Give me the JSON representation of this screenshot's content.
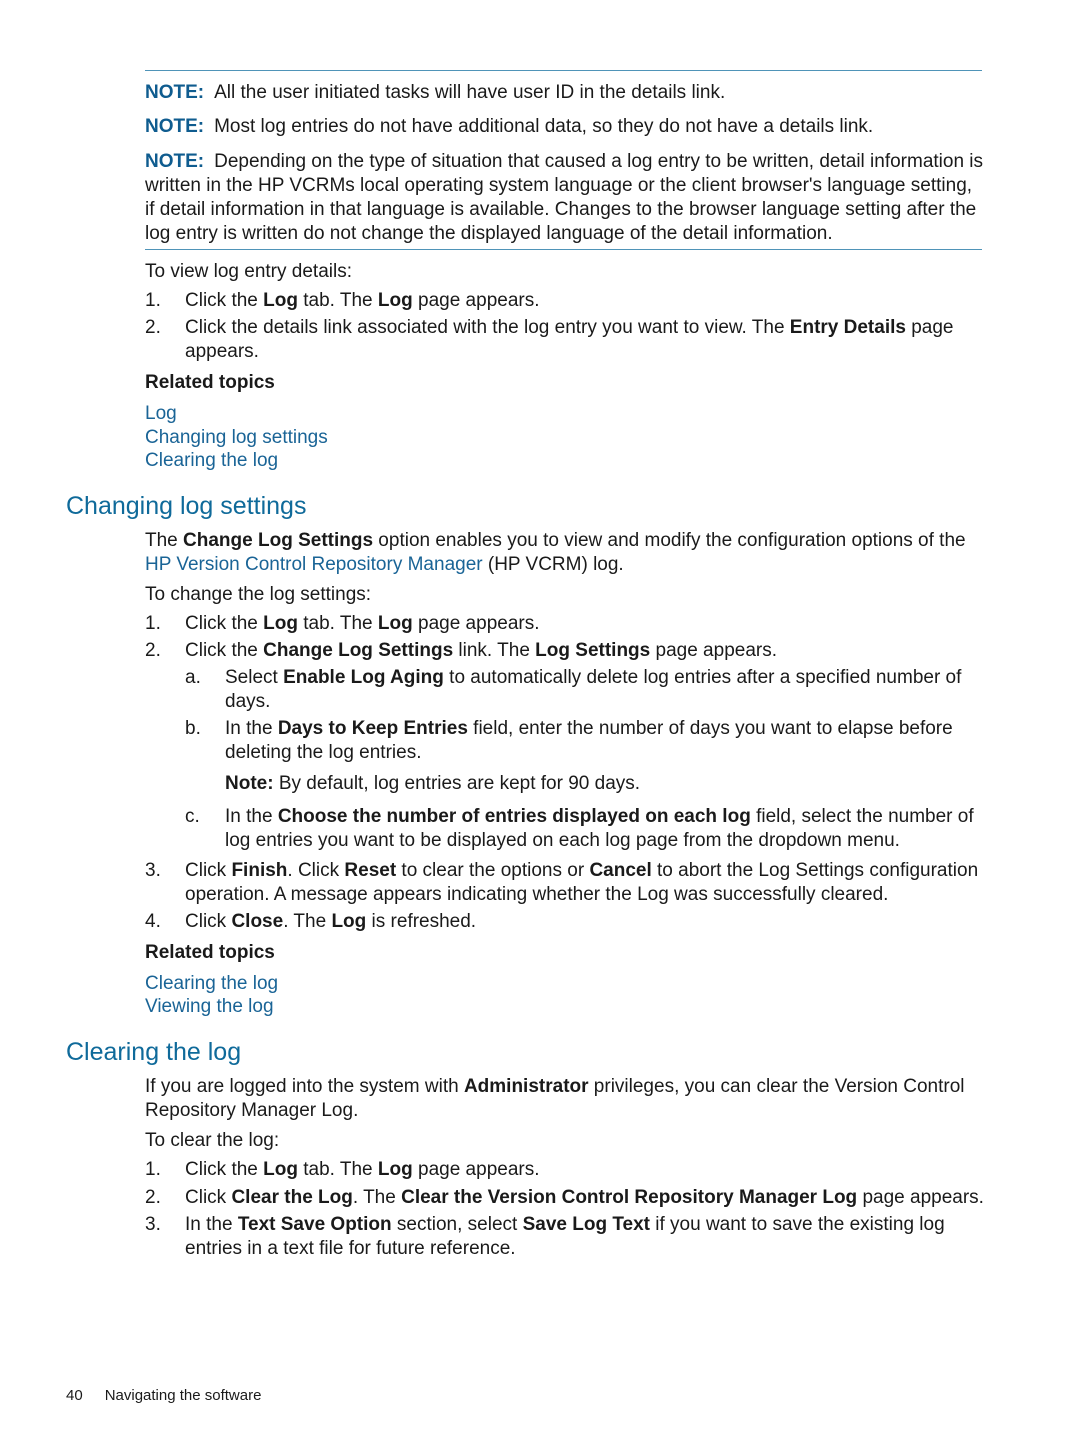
{
  "notes": [
    {
      "label": "NOTE:",
      "text": "All the user initiated tasks will have user ID in the details link."
    },
    {
      "label": "NOTE:",
      "text": "Most log entries do not have additional data, so they do not have a details link."
    },
    {
      "label": "NOTE:",
      "text": "Depending on the type of situation that caused a log entry to be written, detail information is written in the HP VCRMs local operating system language or the client browser's language setting, if detail information in that language is available. Changes to the browser language setting after the log entry is written do not change the displayed language of the detail information."
    }
  ],
  "view_details": {
    "intro": "To view log entry details:",
    "steps": [
      {
        "num": "1.",
        "parts": [
          "Click the ",
          "Log",
          " tab. The ",
          "Log",
          " page appears."
        ]
      },
      {
        "num": "2.",
        "parts": [
          "Click the details link associated with the log entry you want to view. The ",
          "Entry Details",
          " page appears."
        ]
      }
    ],
    "related_label": "Related topics",
    "related_links": [
      "Log",
      "Changing log settings",
      "Clearing the log"
    ]
  },
  "changing_section": {
    "heading": "Changing log settings",
    "intro_parts": [
      "The ",
      "Change Log Settings",
      " option enables you to view and modify the configuration options of the ",
      "HP Version Control Repository Manager",
      " (HP VCRM) log."
    ],
    "lead": "To change the log settings:",
    "steps": [
      {
        "num": "1.",
        "parts": [
          "Click the ",
          "Log",
          " tab. The ",
          "Log",
          " page appears."
        ]
      },
      {
        "num": "2.",
        "parts": [
          "Click the ",
          "Change Log Settings",
          " link. The ",
          "Log Settings",
          " page appears."
        ]
      },
      {
        "num": "3.",
        "parts": [
          "Click ",
          "Finish",
          ". Click ",
          "Reset",
          " to clear the options or ",
          "Cancel",
          " to abort the Log Settings configuration operation. A message appears indicating whether the Log was successfully cleared."
        ]
      },
      {
        "num": "4.",
        "parts": [
          "Click ",
          "Close",
          ". The ",
          "Log",
          " is refreshed."
        ]
      }
    ],
    "substeps": [
      {
        "num": "a.",
        "parts": [
          "Select ",
          "Enable Log Aging",
          " to automatically delete log entries after a specified number of days."
        ]
      },
      {
        "num": "b.",
        "parts": [
          "In the ",
          "Days to Keep Entries",
          " field, enter the number of days you want to elapse before deleting the log entries."
        ]
      },
      {
        "num": "c.",
        "parts": [
          "In the ",
          "Choose the number of entries displayed on each log",
          " field, select the number of log entries you want to be displayed on each log page from the dropdown menu."
        ]
      }
    ],
    "substep_note": {
      "label": "Note:",
      "text": " By default, log entries are kept for 90 days."
    },
    "related_label": "Related topics",
    "related_links": [
      "Clearing the log",
      "Viewing the log"
    ]
  },
  "clearing_section": {
    "heading": "Clearing the log",
    "intro_parts": [
      "If you are logged into the system with ",
      "Administrator",
      " privileges, you can clear the Version Control Repository Manager Log."
    ],
    "lead": "To clear the log:",
    "steps": [
      {
        "num": "1.",
        "parts": [
          "Click the ",
          "Log",
          " tab. The ",
          "Log",
          " page appears."
        ]
      },
      {
        "num": "2.",
        "parts": [
          "Click ",
          "Clear the Log",
          ". The ",
          "Clear the Version Control Repository Manager Log",
          " page appears."
        ]
      },
      {
        "num": "3.",
        "parts": [
          "In the ",
          "Text Save Option",
          " section, select ",
          "Save Log Text",
          " if you want to save the existing log entries in a text file for future reference."
        ]
      }
    ]
  },
  "footer": {
    "page_number": "40",
    "section": "Navigating the software"
  }
}
